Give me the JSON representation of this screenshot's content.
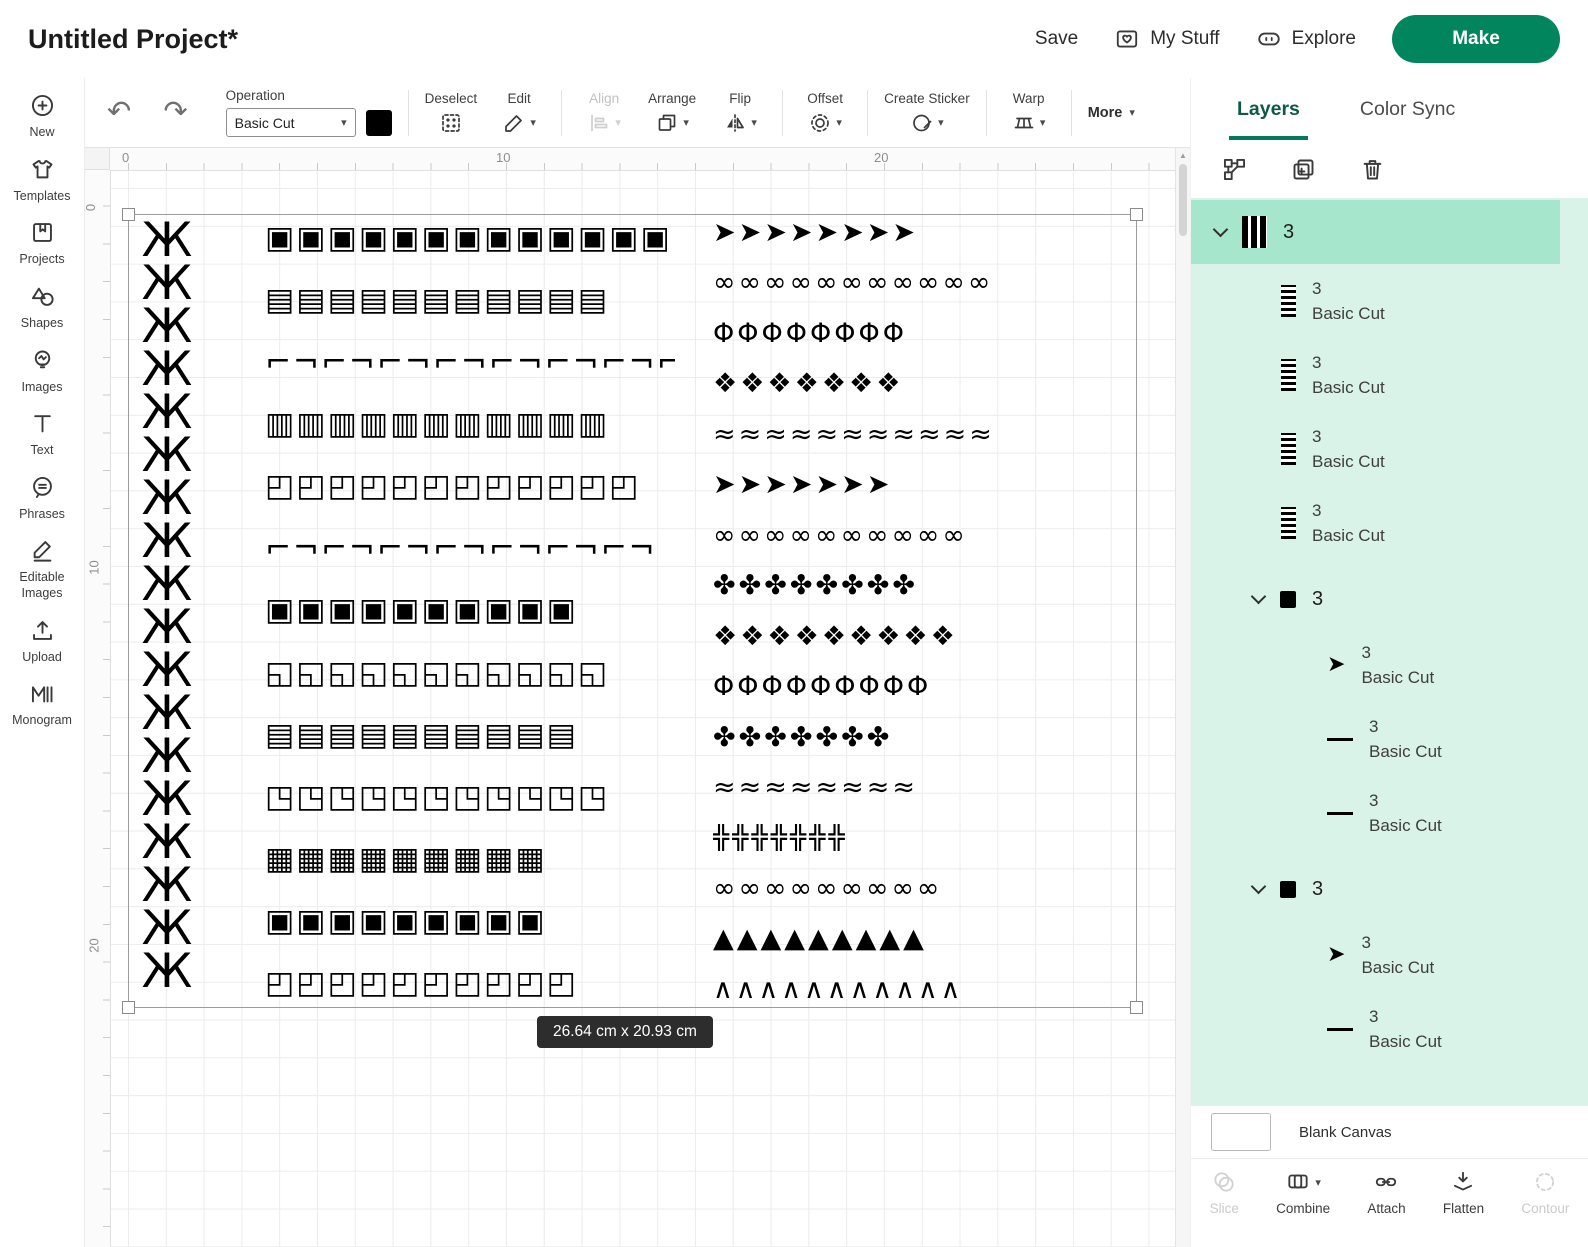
{
  "colors": {
    "accent_green": "#00795c",
    "make_button_green": "#00855c",
    "mint_panel": "#d9f3e8",
    "mint_selected": "#a6e6cd",
    "artwork_black": "#000000"
  },
  "icons": {
    "undo": "↶",
    "redo": "↷",
    "caret": "▾",
    "scroll_up": "▲",
    "leaf_thumb": "➤"
  },
  "header": {
    "title": "Untitled Project*",
    "save": "Save",
    "my_stuff": "My Stuff",
    "explore": "Explore",
    "make": "Make"
  },
  "sidebar": {
    "items": [
      {
        "label": "New"
      },
      {
        "label": "Templates"
      },
      {
        "label": "Projects"
      },
      {
        "label": "Shapes"
      },
      {
        "label": "Images"
      },
      {
        "label": "Text"
      },
      {
        "label": "Phrases"
      },
      {
        "label": "Editable Images"
      },
      {
        "label": "Upload"
      },
      {
        "label": "Monogram"
      }
    ]
  },
  "toolbar": {
    "operation_label": "Operation",
    "operation_value": "Basic Cut",
    "deselect": "Deselect",
    "edit": "Edit",
    "align": "Align",
    "arrange": "Arrange",
    "flip": "Flip",
    "offset": "Offset",
    "create_sticker": "Create Sticker",
    "warp": "Warp",
    "more": "More"
  },
  "canvas": {
    "ruler_h": [
      "0",
      "10",
      "20"
    ],
    "ruler_v": [
      "0",
      "10",
      "20"
    ],
    "size_label": "26.64 cm x 20.93 cm",
    "artwork": {
      "left_column": "ЖЖЖЖЖЖЖЖЖЖЖЖЖЖЖЖЖЖ",
      "middle_rows": [
        "▣▣▣▣▣▣▣▣▣▣▣▣▣",
        "▤▤▤▤▤▤▤▤▤▤▤",
        "⌐¬⌐¬⌐¬⌐¬⌐¬⌐¬⌐¬⌐¬",
        "▥▥▥▥▥▥▥▥▥▥▥",
        "◰◰◰◰◰◰◰◰◰◰◰◰",
        "⌐¬⌐¬⌐¬⌐¬⌐¬⌐¬⌐¬",
        "▣▣▣▣▣▣▣▣▣▣",
        "◱◱◱◱◱◱◱◱◱◱◱",
        "▤▤▤▤▤▤▤▤▤▤",
        "◳◳◳◳◳◳◳◳◳◳◳",
        "▦▦▦▦▦▦▦▦▦",
        "▣▣▣▣▣▣▣▣▣",
        "◰◰◰◰◰◰◰◰◰◰"
      ],
      "right_rows": [
        "➤➤➤➤➤➤➤➤",
        "∞∞∞∞∞∞∞∞∞∞∞",
        "ΦΦΦΦΦΦΦΦ",
        "❖❖❖❖❖❖❖",
        "≈≈≈≈≈≈≈≈≈≈≈",
        "➤➤➤➤➤➤➤",
        "∞∞∞∞∞∞∞∞∞∞",
        "✤✤✤✤✤✤✤✤",
        "❖❖❖❖❖❖❖❖❖",
        "ΦΦΦΦΦΦΦΦΦ",
        "✤✤✤✤✤✤✤",
        "≈≈≈≈≈≈≈≈",
        "╬╬╬╬╬╬╬",
        "∞∞∞∞∞∞∞∞∞",
        "▲▲▲▲▲▲▲▲▲",
        "∧∧∧∧∧∧∧∧∧∧∧"
      ]
    }
  },
  "layers_panel": {
    "tabs": [
      "Layers",
      "Color Sync"
    ],
    "rows": [
      {
        "type": "group",
        "label": "3",
        "selected": true
      },
      {
        "type": "item",
        "label": "3",
        "operation": "Basic Cut",
        "thumb": "pattern"
      },
      {
        "type": "item",
        "label": "3",
        "operation": "Basic Cut",
        "thumb": "pattern"
      },
      {
        "type": "item",
        "label": "3",
        "operation": "Basic Cut",
        "thumb": "pattern"
      },
      {
        "type": "item",
        "label": "3",
        "operation": "Basic Cut",
        "thumb": "pattern"
      },
      {
        "type": "group",
        "label": "3",
        "selected": false
      },
      {
        "type": "item",
        "label": "3",
        "operation": "Basic Cut",
        "thumb": "leaf"
      },
      {
        "type": "item",
        "label": "3",
        "operation": "Basic Cut",
        "thumb": "line"
      },
      {
        "type": "item",
        "label": "3",
        "operation": "Basic Cut",
        "thumb": "line"
      },
      {
        "type": "group",
        "label": "3",
        "selected": false
      },
      {
        "type": "item",
        "label": "3",
        "operation": "Basic Cut",
        "thumb": "leaf"
      },
      {
        "type": "item",
        "label": "3",
        "operation": "Basic Cut",
        "thumb": "line"
      }
    ],
    "blank_canvas": "Blank Canvas",
    "actions": [
      {
        "label": "Slice",
        "enabled": false
      },
      {
        "label": "Combine",
        "enabled": true
      },
      {
        "label": "Attach",
        "enabled": true
      },
      {
        "label": "Flatten",
        "enabled": true
      },
      {
        "label": "Contour",
        "enabled": false
      }
    ]
  }
}
